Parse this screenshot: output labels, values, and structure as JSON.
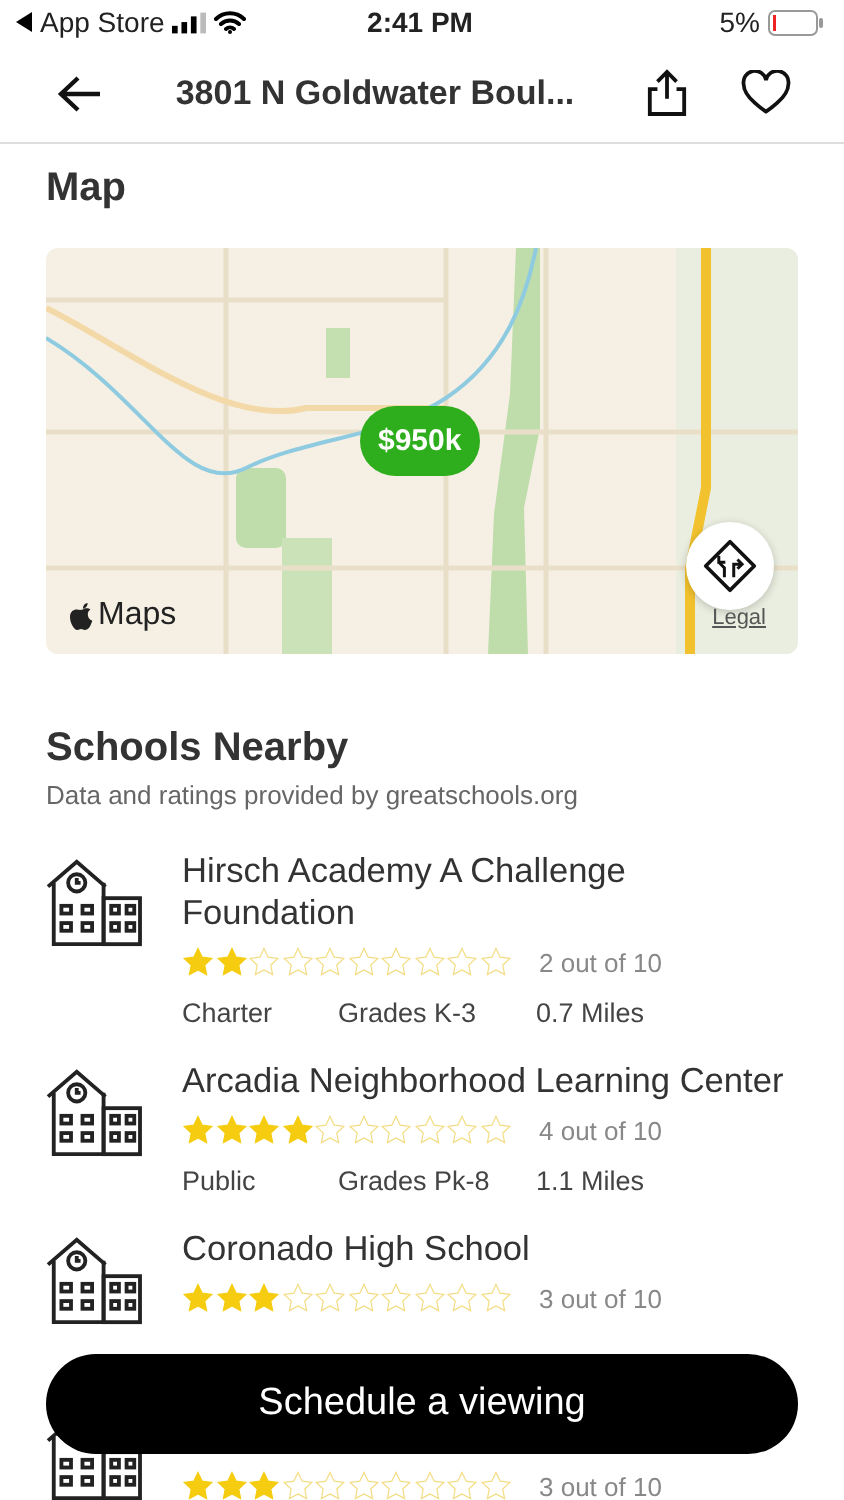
{
  "status_bar": {
    "back_label": "App Store",
    "time": "2:41 PM",
    "battery": "5%"
  },
  "nav": {
    "title": "3801 N Goldwater Boul..."
  },
  "map_section": {
    "heading": "Map",
    "price_pin": "$950k",
    "maps_logo": "Maps",
    "legal_link": "Legal"
  },
  "schools_section": {
    "heading": "Schools Nearby",
    "subtitle": "Data and ratings provided by greatschools.org"
  },
  "schools": [
    {
      "name": "Hirsch Academy A Challenge Foundation",
      "stars": 2,
      "rating": "2 out of 10",
      "type": "Charter",
      "grades": "Grades K-3",
      "distance": "0.7 Miles"
    },
    {
      "name": "Arcadia Neighborhood Learning Center",
      "stars": 4,
      "rating": "4 out of 10",
      "type": "Public",
      "grades": "Grades Pk-8",
      "distance": "1.1 Miles"
    },
    {
      "name": "Coronado High School",
      "stars": 3,
      "rating": "3 out of 10"
    },
    {
      "stars": 3,
      "rating": "3 out of 10"
    }
  ],
  "cta_button": "Schedule a viewing"
}
